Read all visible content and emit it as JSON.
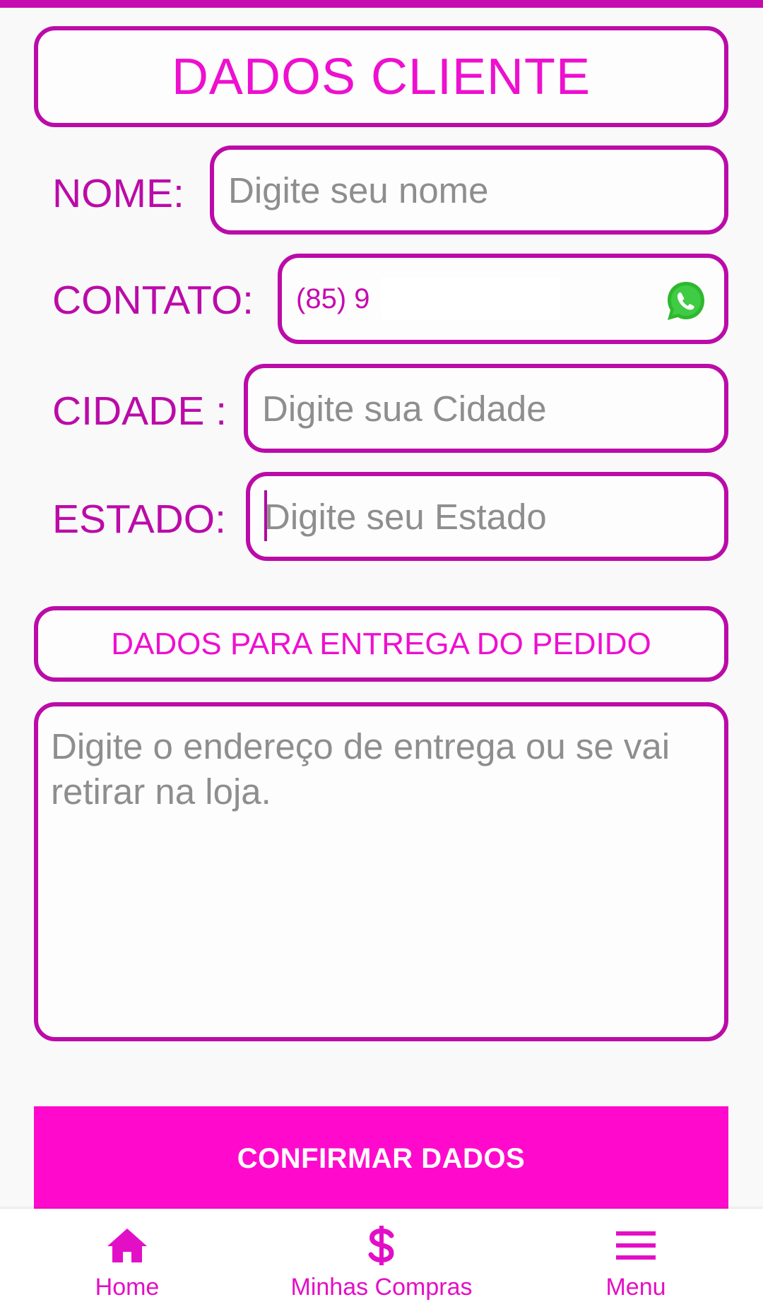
{
  "header": {
    "title": "DADOS CLIENTE"
  },
  "form": {
    "nome": {
      "label": "NOME:",
      "placeholder": "Digite seu nome"
    },
    "contato": {
      "label": "CONTATO:",
      "value": "(85) 9",
      "icon": "whatsapp-icon"
    },
    "cidade": {
      "label": "CIDADE :",
      "placeholder": "Digite sua Cidade"
    },
    "estado": {
      "label": "ESTADO:",
      "placeholder": "Digite seu Estado"
    }
  },
  "delivery": {
    "title": "DADOS PARA ENTREGA DO PEDIDO",
    "placeholder": "Digite o endereço de entrega ou se vai retirar na loja."
  },
  "confirm_label": "CONFIRMAR DADOS",
  "nav": {
    "items": [
      {
        "label": "Home",
        "icon": "home-icon"
      },
      {
        "label": "Minhas Compras",
        "icon": "dollar-icon"
      },
      {
        "label": "Menu",
        "icon": "menu-icon"
      }
    ]
  },
  "colors": {
    "accent": "#bb0ba8",
    "brand": "#ff0acd",
    "title": "#ee0fcf",
    "placeholder": "#8e8e8e"
  }
}
